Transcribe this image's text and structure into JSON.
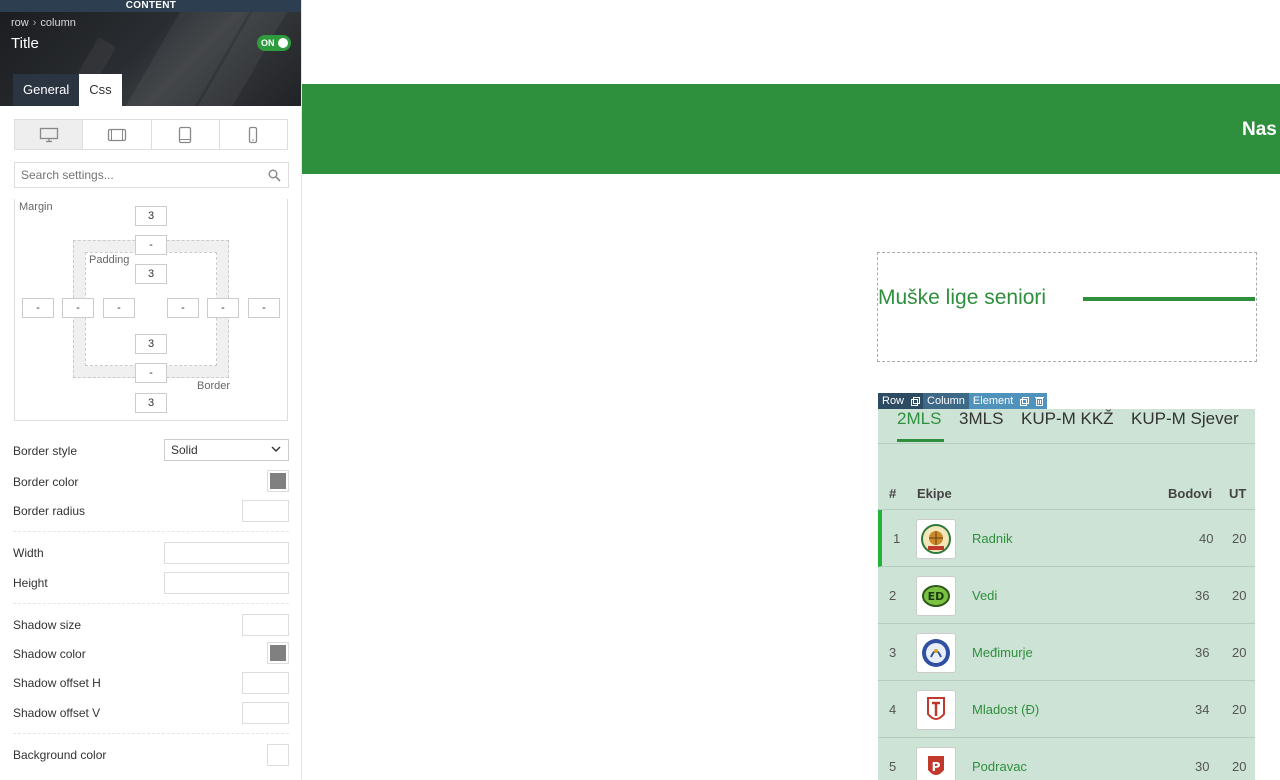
{
  "panel": {
    "top_label": "CONTENT",
    "breadcrumb": [
      "row",
      "column"
    ],
    "breadcrumb_sep": "›",
    "title": "Title",
    "toggle_label": "ON",
    "tabs": [
      {
        "label": "General",
        "active": false
      },
      {
        "label": "Css",
        "active": true
      }
    ],
    "devices": [
      "desktop-icon",
      "tablet-landscape-icon",
      "tablet-portrait-icon",
      "mobile-icon"
    ],
    "search_placeholder": "Search settings...",
    "box_model": {
      "margin_label": "Margin",
      "padding_label": "Padding",
      "border_label": "Border",
      "margin": {
        "top": "3",
        "right": "-",
        "bottom": "3",
        "left": "-"
      },
      "border": {
        "top": "-",
        "right": "-",
        "bottom": "-",
        "left": "-"
      },
      "padding": {
        "top": "3",
        "right": "-",
        "bottom": "3",
        "left": "-"
      }
    },
    "props": {
      "border_style": "Border style",
      "border_style_value": "Solid",
      "border_color": "Border color",
      "border_radius": "Border radius",
      "width": "Width",
      "height": "Height",
      "shadow_size": "Shadow size",
      "shadow_color": "Shadow color",
      "shadow_offset_h": "Shadow offset H",
      "shadow_offset_v": "Shadow offset V",
      "background_color": "Background color"
    },
    "swatch_color": "#808080"
  },
  "content": {
    "nav_text": "Nas",
    "section_title": "Muške lige seniori",
    "toolbar": {
      "row": "Row",
      "column": "Column",
      "element": "Element"
    },
    "league_tabs": [
      "2MLS",
      "3MLS",
      "KUP-M KKŽ",
      "KUP-M Sjever"
    ],
    "table": {
      "headers": {
        "rank": "#",
        "team": "Ekipe",
        "points": "Bodovi",
        "games": "UT"
      },
      "rows": [
        {
          "rank": "1",
          "team": "Radnik",
          "points": "40",
          "games": "20"
        },
        {
          "rank": "2",
          "team": "Vedi",
          "points": "36",
          "games": "20"
        },
        {
          "rank": "3",
          "team": "Međimurje",
          "points": "36",
          "games": "20"
        },
        {
          "rank": "4",
          "team": "Mladost (Đ)",
          "points": "34",
          "games": "20"
        },
        {
          "rank": "5",
          "team": "Podravac",
          "points": "30",
          "games": "20"
        }
      ]
    },
    "accent_color": "#2e8f3c"
  }
}
